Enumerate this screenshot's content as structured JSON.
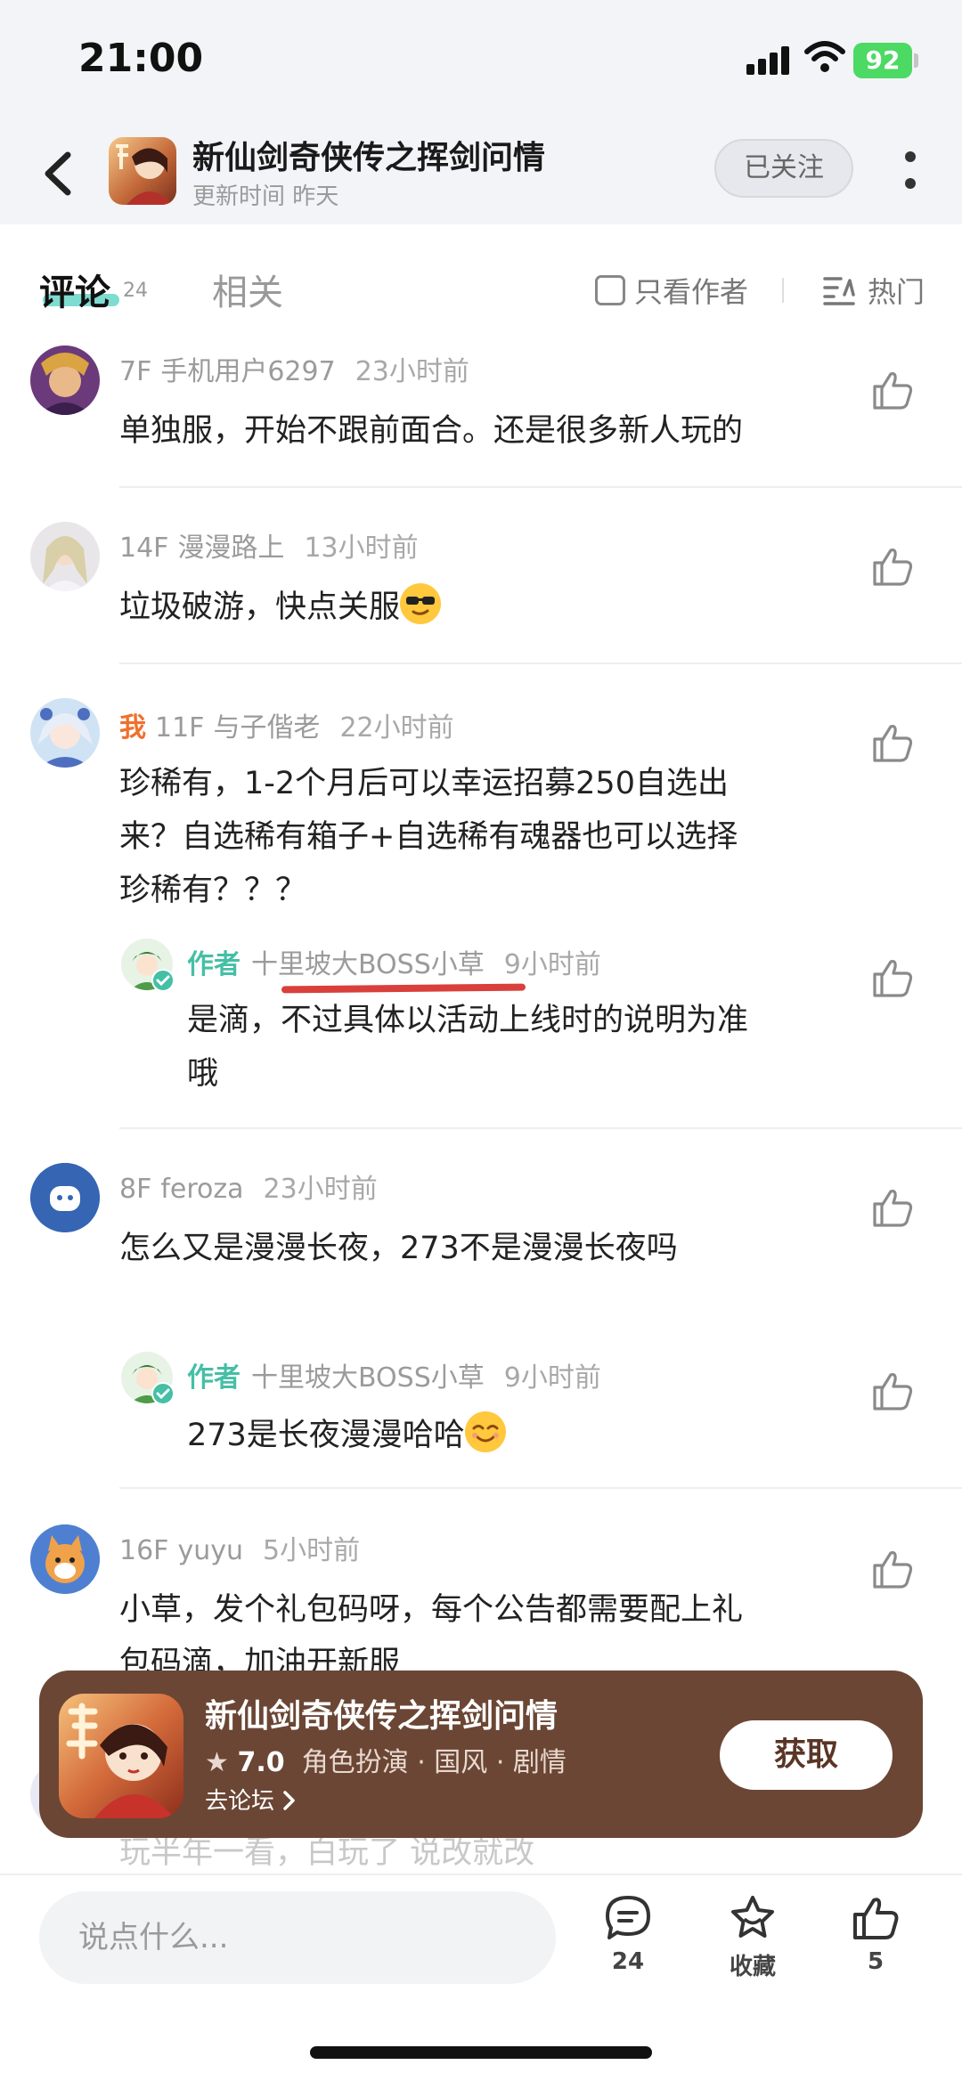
{
  "status_bar": {
    "time": "21:00",
    "battery": "92"
  },
  "header": {
    "title": "新仙剑奇侠传之挥剑问情",
    "subtitle": "更新时间 昨天",
    "follow_label": "已关注"
  },
  "tabs": {
    "comments_label": "评论",
    "comments_count": "24",
    "related_label": "相关",
    "author_only_label": "只看作者",
    "sort_label": "热门"
  },
  "comments": [
    {
      "floor": "7F",
      "user": "手机用户6297",
      "time": "23小时前",
      "lines": [
        "单独服，开始不跟前面合。还是很多新人玩的"
      ]
    },
    {
      "floor": "14F",
      "user": "漫漫路上",
      "time": "13小时前",
      "lines": [
        "垃圾破游，快点关服"
      ]
    },
    {
      "me": "我",
      "floor": "11F",
      "user": "与子偕老",
      "time": "22小时前",
      "lines": [
        "珍稀有，1-2个月后可以幸运招募250自选出",
        "来？自选稀有箱子+自选稀有魂器也可以选择",
        "珍稀有？？？"
      ],
      "reply": {
        "tag": "作者",
        "user": "十里坡大BOSS小草",
        "time": "9小时前",
        "lines": [
          "是滴，不过具体以活动上线时的说明为准",
          "哦"
        ]
      }
    },
    {
      "floor": "8F",
      "user": "feroza",
      "time": "23小时前",
      "lines": [
        "怎么又是漫漫长夜，273不是漫漫长夜吗"
      ],
      "reply": {
        "tag": "作者",
        "user": "十里坡大BOSS小草",
        "time": "9小时前",
        "lines": [
          "273是长夜漫漫哈哈"
        ]
      }
    },
    {
      "floor": "16F",
      "user": "yuyu",
      "time": "5小时前",
      "lines": [
        "小草，发个礼包码呀，每个公告都需要配上礼",
        "包码滴，加油开新服"
      ]
    }
  ],
  "partial_comment_text": "玩半年一看，白玩了 说改就改",
  "banner": {
    "title": "新仙剑奇侠传之挥剑问情",
    "rating": "7.0",
    "tags": "角色扮演 · 国风 · 剧情",
    "forum_link": "去论坛",
    "get_label": "获取"
  },
  "bottom_bar": {
    "input_placeholder": "说点什么...",
    "comment_count": "24",
    "favorite_label": "收藏",
    "like_count": "5"
  },
  "colors": {
    "accent_teal": "#45bfa6",
    "me_orange": "#f0702d",
    "banner_brown": "#6b4635",
    "underline_red": "#d9403b"
  }
}
